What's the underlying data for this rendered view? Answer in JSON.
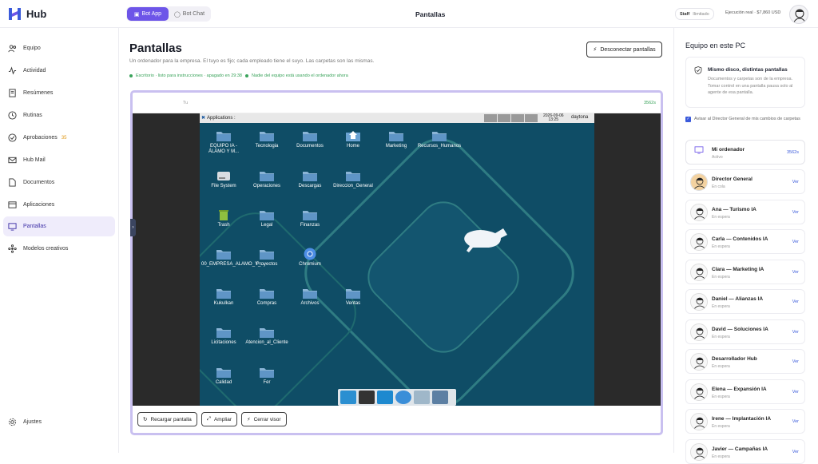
{
  "app": {
    "name": "Hub"
  },
  "topbar": {
    "tabs": [
      {
        "label": "Bot App",
        "active": true
      },
      {
        "label": "Bot Chat",
        "active": false
      }
    ],
    "title": "Pantallas",
    "staff_label": "Staff",
    "staff_value": "Ilimitado",
    "exec_label": "Ejecución real · $7,860 USD"
  },
  "sidebar": {
    "items": [
      {
        "label": "Equipo",
        "icon": "users-icon"
      },
      {
        "label": "Actividad",
        "icon": "activity-icon"
      },
      {
        "label": "Resúmenes",
        "icon": "document-icon"
      },
      {
        "label": "Rutinas",
        "icon": "clock-icon"
      },
      {
        "label": "Aprobaciones",
        "icon": "check-circle-icon",
        "badge": "35"
      },
      {
        "label": "Hub Mail",
        "icon": "mail-icon"
      },
      {
        "label": "Documentos",
        "icon": "file-icon"
      },
      {
        "label": "Aplicaciones",
        "icon": "window-icon"
      },
      {
        "label": "Pantallas",
        "icon": "monitor-icon",
        "active": true
      },
      {
        "label": "Modelos creativos",
        "icon": "sparkle-icon"
      }
    ],
    "settings_label": "Ajustes"
  },
  "main": {
    "title": "Pantallas",
    "subtitle": "Un ordenador para la empresa. El tuyo es fijo; cada empleado tiene el suyo. Las carpetas son las mismas.",
    "status": "Escritorio · listo para instrucciones · apagado en 29:38",
    "status_extra": "Nadie del equipo está usando el ordenador ahora",
    "disconnect_label": "Desconectar pantallas",
    "viewer": {
      "bar_left": "Tu",
      "bar_right": "3562s",
      "panel_apps": "Applications :",
      "clock_date": "2026-09-06",
      "clock_time": "13:25",
      "hostname": "daytona",
      "icons": [
        {
          "label": "EQUIPO IA - ÁLAMO Y M...",
          "kind": "folder"
        },
        {
          "label": "Tecnologia",
          "kind": "folder"
        },
        {
          "label": "Documentos",
          "kind": "folder"
        },
        {
          "label": "Home",
          "kind": "home"
        },
        {
          "label": "Marketing",
          "kind": "folder"
        },
        {
          "label": "Recursos_Humanos",
          "kind": "folder"
        },
        {
          "label": "File System",
          "kind": "drive"
        },
        {
          "label": "Operaciones",
          "kind": "folder"
        },
        {
          "label": "Descargas",
          "kind": "folder"
        },
        {
          "label": "Direccion_General",
          "kind": "folder"
        },
        {
          "label": "Trash",
          "kind": "trash"
        },
        {
          "label": "Legal",
          "kind": "folder"
        },
        {
          "label": "Finanzas",
          "kind": "folder"
        },
        {
          "label": "00_EMPRESA_ALAMO_Y_...",
          "kind": "folder"
        },
        {
          "label": "Proyectos",
          "kind": "folder"
        },
        {
          "label": "Chromium",
          "kind": "chromium"
        },
        {
          "label": "Kukulkan",
          "kind": "folder"
        },
        {
          "label": "Compras",
          "kind": "folder"
        },
        {
          "label": "Archivos",
          "kind": "folder"
        },
        {
          "label": "Ventas",
          "kind": "folder"
        },
        {
          "label": "Licitaciones",
          "kind": "folder"
        },
        {
          "label": "Atencion_al_Cliente",
          "kind": "folder"
        },
        {
          "label": "Calidad",
          "kind": "folder"
        },
        {
          "label": "Fer",
          "kind": "folder"
        }
      ]
    },
    "buttons": {
      "reload": "Recargar pantalla",
      "expand": "Ampliar",
      "close": "Cerrar visor"
    }
  },
  "right": {
    "title": "Equipo en este PC",
    "info_title": "Mismo disco, distintas pantallas",
    "info_text": "Documentos y carpetas son de la empresa. Tomar control en una pantalla pausa solo al agente de esa pantalla.",
    "checkbox_label": "Avisar al Director General de mis cambios de carpetas",
    "my_pc": {
      "name": "Mi ordenador",
      "state": "Activo",
      "time": "3562s"
    },
    "view_label": "Ver",
    "agents": [
      {
        "name": "Director General",
        "state": "En cola"
      },
      {
        "name": "Ana — Turismo IA",
        "state": "En espera"
      },
      {
        "name": "Carla — Contenidos IA",
        "state": "En espera"
      },
      {
        "name": "Clara — Marketing IA",
        "state": "En espera"
      },
      {
        "name": "Daniel — Alianzas IA",
        "state": "En espera"
      },
      {
        "name": "David — Soluciones IA",
        "state": "En espera"
      },
      {
        "name": "Desarrollador Hub",
        "state": "En espera"
      },
      {
        "name": "Elena — Expansión IA",
        "state": "En espera"
      },
      {
        "name": "Irene — Implantación IA",
        "state": "En espera"
      },
      {
        "name": "Javier — Campañas IA",
        "state": "En espera"
      }
    ]
  }
}
